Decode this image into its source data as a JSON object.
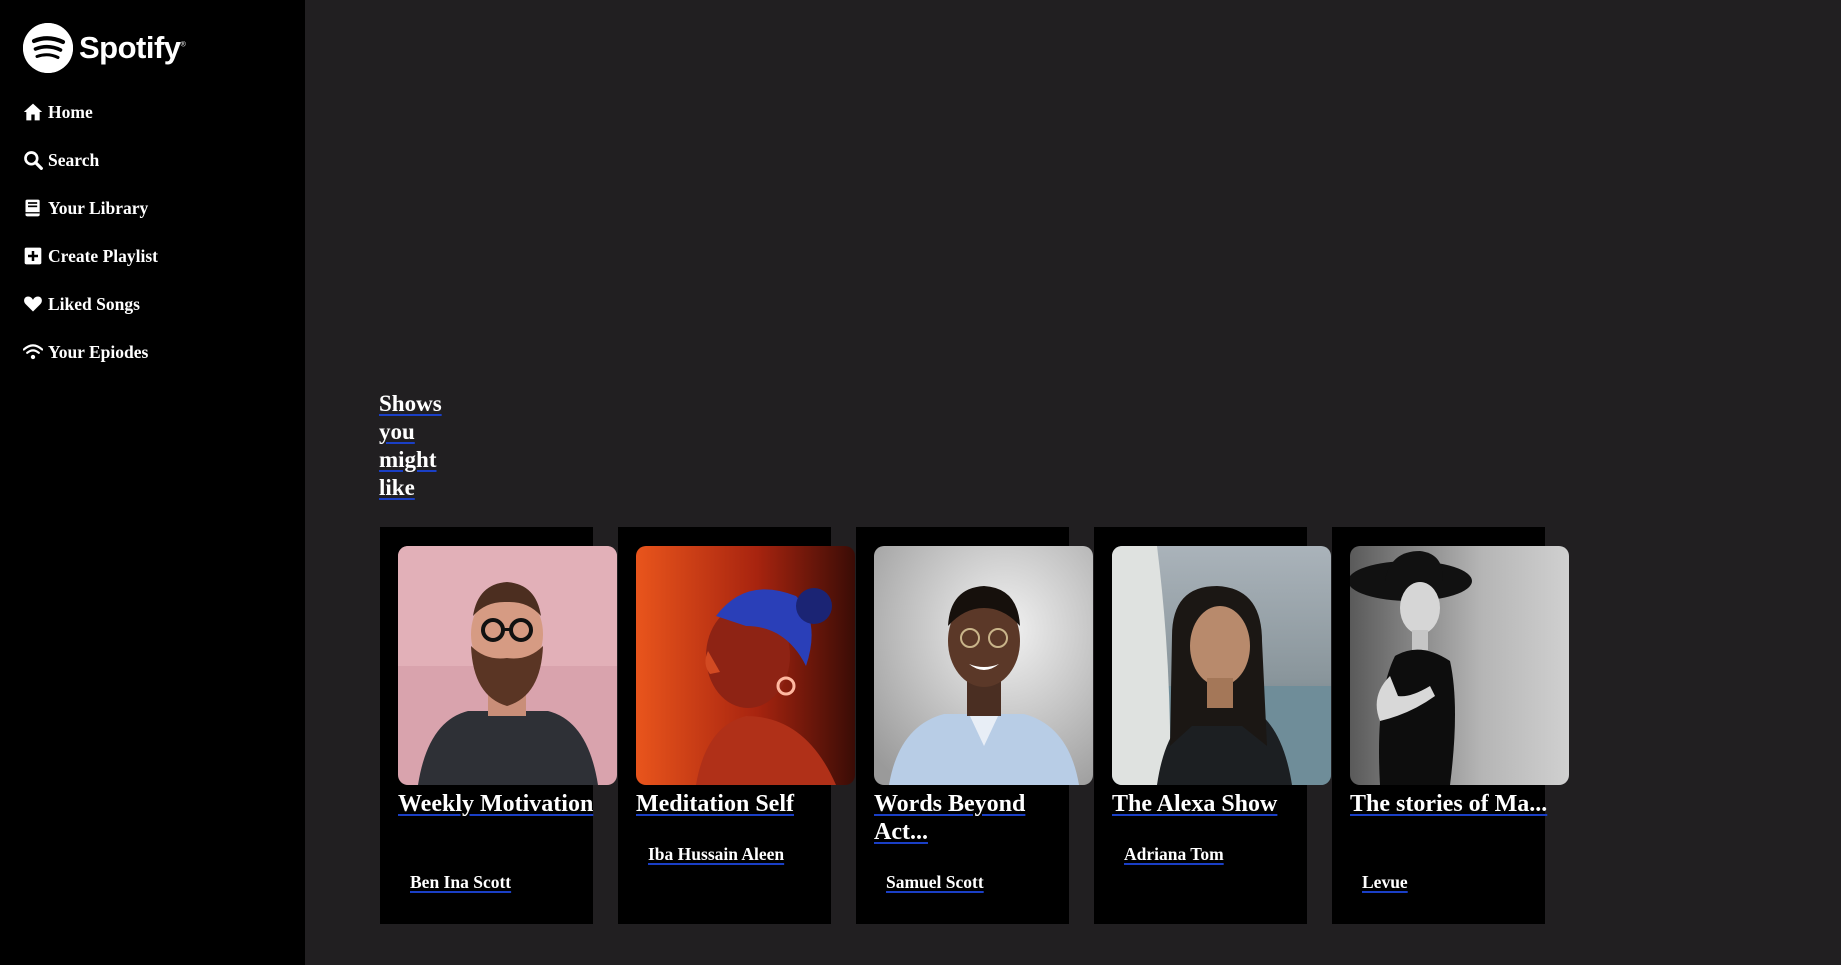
{
  "brand": {
    "name": "Spotify",
    "trademark": "®"
  },
  "sidebar": {
    "items": [
      {
        "label": "Home",
        "icon": "home-icon"
      },
      {
        "label": "Search",
        "icon": "search-icon"
      },
      {
        "label": "Your Library",
        "icon": "library-icon"
      },
      {
        "label": "Create Playlist",
        "icon": "plus-square-icon"
      },
      {
        "label": "Liked Songs",
        "icon": "heart-icon"
      },
      {
        "label": "Your Epiodes",
        "icon": "wifi-icon"
      }
    ]
  },
  "main": {
    "section_title": "Shows you might like",
    "shows": [
      {
        "title": "Weekly Motivation",
        "author": "Ben Ina Scott",
        "image": "portrait-bearded-man-pink-background"
      },
      {
        "title": "Meditation Self",
        "author": "Iba Hussain Aleen",
        "image": "portrait-woman-red-blue-light"
      },
      {
        "title": "Words Beyond Act...",
        "author": "Samuel Scott",
        "image": "portrait-smiling-man-glasses"
      },
      {
        "title": "The Alexa Show",
        "author": "Adriana Tom",
        "image": "portrait-woman-beach"
      },
      {
        "title": "The stories of Ma...",
        "author": "Levue",
        "image": "portrait-woman-black-hat"
      }
    ]
  },
  "colors": {
    "sidebar_bg": "#000000",
    "main_bg": "#211f21",
    "card_bg": "#000000",
    "text": "#ffffff",
    "link_underline": "#1a3fc6"
  }
}
